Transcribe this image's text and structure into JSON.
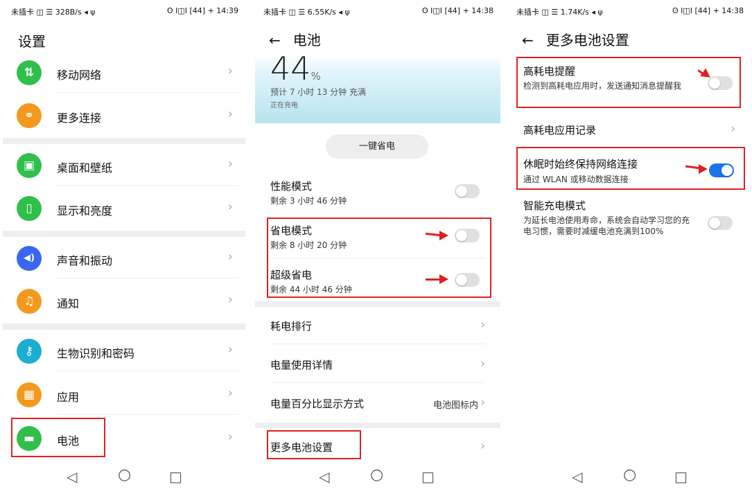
{
  "panels": {
    "settings": {
      "status_left": "未插卡 ◫ ☰ 328B/s ◂ ψ",
      "status_right": "ʘ I◫I [44] + 14:39",
      "title": "设置",
      "items": [
        {
          "label": "移动网络",
          "icon": "mobile-network-icon",
          "color": "#2fbf4a",
          "glyph": "⇅"
        },
        {
          "label": "更多连接",
          "icon": "link-icon",
          "color": "#f39a1e",
          "glyph": "⚭"
        },
        {
          "label": "桌面和壁纸",
          "icon": "wallpaper-icon",
          "color": "#2fbf4a",
          "glyph": "▣"
        },
        {
          "label": "显示和亮度",
          "icon": "display-icon",
          "color": "#2fbf4a",
          "glyph": "▯"
        },
        {
          "label": "声音和振动",
          "icon": "sound-icon",
          "color": "#3a67f0",
          "glyph": "◀)"
        },
        {
          "label": "通知",
          "icon": "notification-bell-icon",
          "color": "#f39a1e",
          "glyph": "♫"
        },
        {
          "label": "生物识别和密码",
          "icon": "key-icon",
          "color": "#1aaed0",
          "glyph": "⚷"
        },
        {
          "label": "应用",
          "icon": "apps-grid-icon",
          "color": "#f39a1e",
          "glyph": "▦"
        },
        {
          "label": "电池",
          "icon": "battery-icon",
          "color": "#2fbf4a",
          "glyph": "▬"
        }
      ],
      "chevron": "›"
    },
    "battery": {
      "status_left": "未插卡 ◫ ☰ 6.55K/s ◂ ψ",
      "status_right": "ʘ I◫I [44] + 14:38",
      "back": "←",
      "title": "电池",
      "percent": "44",
      "percent_unit": "%",
      "estimate": "预计 7 小时 13 分钟 充满",
      "charging": "正在充电",
      "one_key_save": "一键省电",
      "modes": [
        {
          "title": "性能模式",
          "sub": "剩余 3 小时 46 分钟",
          "on": false
        },
        {
          "title": "省电模式",
          "sub": "剩余 8 小时 20 分钟",
          "on": false
        },
        {
          "title": "超级省电",
          "sub": "剩余 44 小时 46 分钟",
          "on": false
        }
      ],
      "rank": "耗电排行",
      "usage_detail": "电量使用详情",
      "percent_display": "电量百分比显示方式",
      "percent_display_value": "电池图标内",
      "more_settings": "更多电池设置",
      "chevron": "›"
    },
    "more_battery": {
      "status_left": "未插卡 ◫ ☰ 1.74K/s ◂ ψ",
      "status_right": "ʘ I◫I [44] + 14:38",
      "back": "←",
      "title": "更多电池设置",
      "high_power_title": "高耗电提醒",
      "high_power_sub": "检测到高耗电应用时，发送通知消息提醒我",
      "high_power_on": false,
      "high_power_record": "高耗电应用记录",
      "sleep_network_title": "休眠时始终保持网络连接",
      "sleep_network_sub": "通过 WLAN 或移动数据连接",
      "sleep_network_on": true,
      "smart_charge_title": "智能充电模式",
      "smart_charge_sub": "为延长电池使用寿命，系统会自动学习您的充电习惯，需要时减缓电池充满到100%",
      "smart_charge_on": false,
      "chevron": "›"
    }
  },
  "nav": {
    "back": "◁",
    "home": "○",
    "recent": "□"
  },
  "colors": {
    "highlight": "#e02020",
    "toggle_on": "#1a73e8"
  }
}
